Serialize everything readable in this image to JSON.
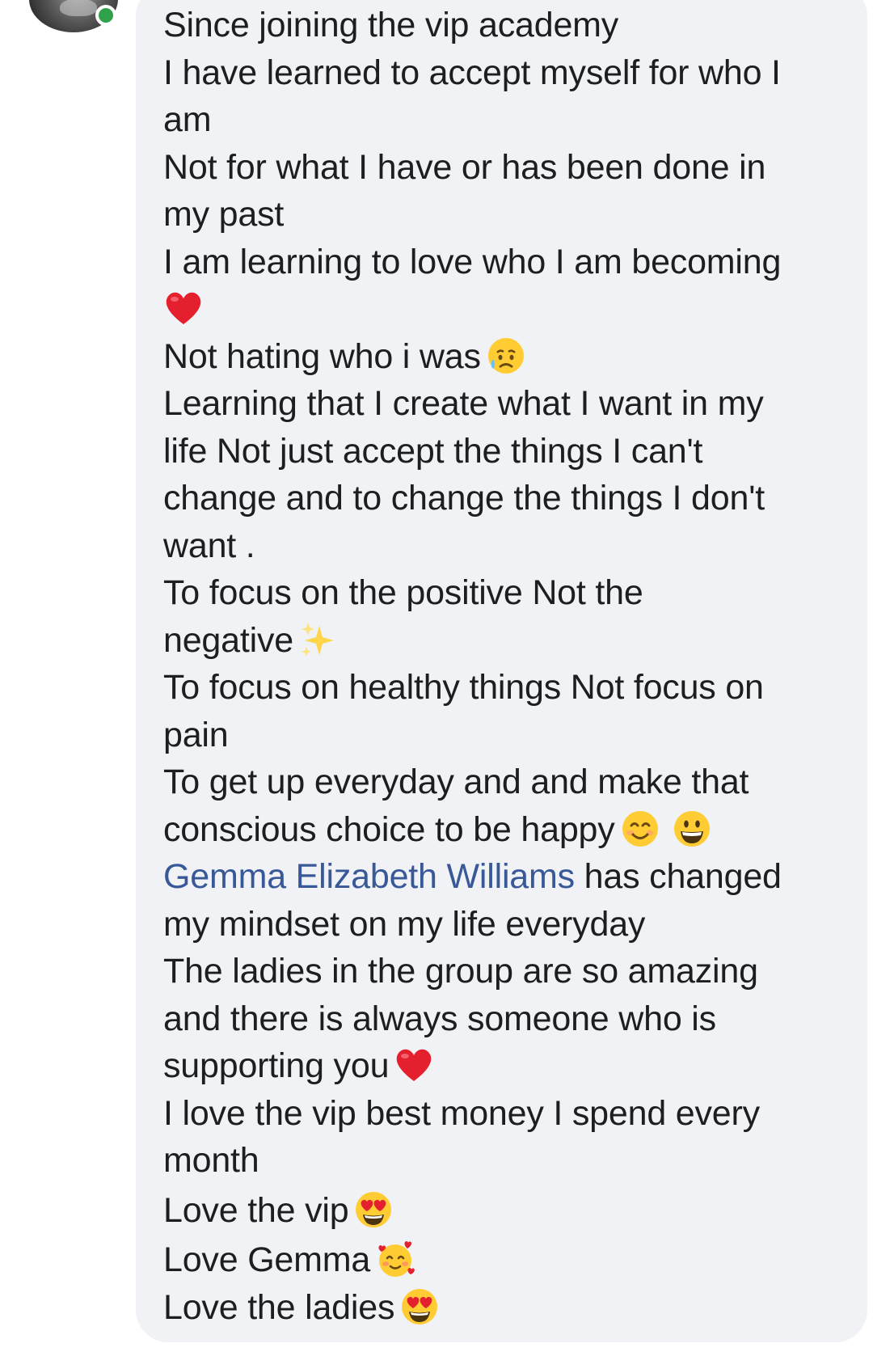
{
  "comment": {
    "lines": [
      "Since joining the vip academy",
      "I have learned to accept myself for who I",
      "am",
      "Not for what I have or has been done in",
      "my past",
      "I am learning to love who I am becoming",
      "",
      "Not hating who i was",
      "Learning that I create what I want in my",
      "life Not just accept the things I can't",
      "change and to change the things I don't",
      "want .",
      "To focus on the positive Not the",
      "negative",
      "To focus on healthy things Not focus on",
      "pain",
      "To get up everyday and and make that",
      "conscious choice to be happy",
      "",
      "my mindset on my life everyday",
      "The ladies in the group are so amazing",
      "and there is always someone who is",
      "supporting you",
      "I love the vip best money I spend every",
      "month",
      "Love the vip",
      "Love Gemma",
      "Love the ladies"
    ],
    "mention": "Gemma Elizabeth Williams",
    "mention_suffix": " has changed"
  },
  "emoji_icons": {
    "line_7": "red-heart-emoji",
    "line_8": "sad-relieved-face-emoji",
    "line_14": "sparkles-emoji",
    "line_18": [
      "smiling-face-emoji",
      "grinning-face-emoji"
    ],
    "line_23": "red-heart-emoji",
    "line_26": "heart-eyes-emoji",
    "line_27": "smiling-face-with-hearts-emoji",
    "line_28": "heart-eyes-emoji"
  },
  "colors": {
    "bubble_background": "#f0f2f5",
    "text": "#1c1e21",
    "mention": "#385898",
    "online_indicator": "#31a24c"
  }
}
